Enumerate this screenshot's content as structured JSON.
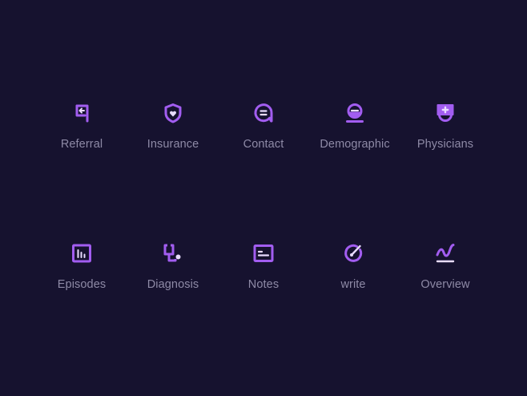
{
  "colors": {
    "background": "#16122f",
    "icon_main": "#a25df0",
    "icon_light": "#e9dcff",
    "label": "#8e8aa6"
  },
  "icons": [
    {
      "label": "Referral",
      "icon": "referral-icon"
    },
    {
      "label": "Insurance",
      "icon": "insurance-icon"
    },
    {
      "label": "Contact",
      "icon": "contact-icon"
    },
    {
      "label": "Demographic",
      "icon": "demographic-icon"
    },
    {
      "label": "Physicians",
      "icon": "physicians-icon"
    },
    {
      "label": "Episodes",
      "icon": "episodes-icon"
    },
    {
      "label": "Diagnosis",
      "icon": "diagnosis-icon"
    },
    {
      "label": "Notes",
      "icon": "notes-icon"
    },
    {
      "label": "write",
      "icon": "write-icon"
    },
    {
      "label": "Overview",
      "icon": "overview-icon"
    }
  ]
}
